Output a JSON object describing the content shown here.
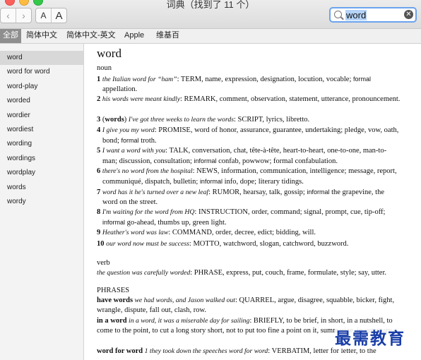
{
  "window": {
    "title": "词典（找到了 11 个）"
  },
  "toolbar": {
    "back": "‹",
    "forward": "›",
    "font_small": "A",
    "font_large": "A"
  },
  "search": {
    "value": "word",
    "clear": "✕"
  },
  "tabs": [
    "全部",
    "简体中文",
    "简体中文-英文",
    "Apple",
    "维基百"
  ],
  "sidebar": [
    "word",
    "word for word",
    "word-play",
    "worded",
    "wordier",
    "wordiest",
    "wording",
    "wordings",
    "wordplay",
    "words",
    "wordy"
  ],
  "entry": {
    "headword": "word",
    "noun_label": "noun",
    "senses": [
      {
        "num": "1",
        "eg": "the Italian word for “ham”",
        "a": ": TERM, name, expression, designation, locution, vocable; ",
        "r": "formal",
        "b": " appellation."
      },
      {
        "num": "2",
        "eg": "his words were meant kindly",
        "a": ": REMARK, comment, observation, statement, utterance, pronouncement.",
        "r": "",
        "b": ""
      },
      {
        "num": "3",
        "bold": "words",
        "eg": "I've got three weeks to learn the words",
        "a": ": SCRIPT, lyrics, libretto.",
        "r": "",
        "b": ""
      },
      {
        "num": "4",
        "eg": "I give you my word",
        "a": ": PROMISE, word of honor, assurance, guarantee, undertaking; pledge, vow, oath, bond; ",
        "r": "formal",
        "b": " troth."
      },
      {
        "num": "5",
        "eg": "I want a word with you",
        "a": ": TALK, conversation, chat, tête-à-tête, heart-to-heart, one-to-one, man-to-man; discussion, consultation; ",
        "r": "informal",
        "b": " confab, powwow; formal confabulation."
      },
      {
        "num": "6",
        "eg": "there's no word from the hospital",
        "a": ": NEWS, information, communication, intelligence; message, report, communiqué, dispatch, bulletin; ",
        "r": "informal",
        "b": " info, dope; literary tidings."
      },
      {
        "num": "7",
        "eg": "word has it he's turned over a new leaf",
        "a": ": RUMOR, hearsay, talk, gossip; ",
        "r": "informal",
        "b": " the grapevine, the word on the street."
      },
      {
        "num": "8",
        "eg": "I'm waiting for the word from HQ",
        "a": ": INSTRUCTION, order, command; signal, prompt, cue, tip-off; ",
        "r": "informal",
        "b": " go-ahead, thumbs up, green light."
      },
      {
        "num": "9",
        "eg": "Heather's word was law",
        "a": ": COMMAND, order, decree, edict; bidding, will.",
        "r": "",
        "b": ""
      },
      {
        "num": "10",
        "eg": "our word now must be success",
        "a": ": MOTTO, watchword, slogan, catchword, buzzword.",
        "r": "",
        "b": ""
      }
    ],
    "verb_label": "verb",
    "verb": {
      "eg": "the question was carefully worded",
      "a": ": PHRASE, express, put, couch, frame, formulate, style; say, utter."
    },
    "phrases_label": "PHRASES",
    "phrases": [
      {
        "head": "have words",
        "eg": " we had words, and Jason walked out",
        "a": ": QUARREL, argue, disagree, squabble, bicker, fight, wrangle, dispute, fall out, clash, row."
      },
      {
        "head": "in a word",
        "eg": " in a word, it was a miserable day for sailing",
        "a": ": BRIEFLY, to be brief, in short, in a nutshell, to come to the point, to cut a long story short, not to put too fine a point on it, summarize, in summary."
      },
      {
        "head": "word for word",
        "eg": " 1 they took down the speeches word for word",
        "a": ": VERBATIM, letter for letter, to the"
      }
    ]
  },
  "watermark": "最需教育"
}
